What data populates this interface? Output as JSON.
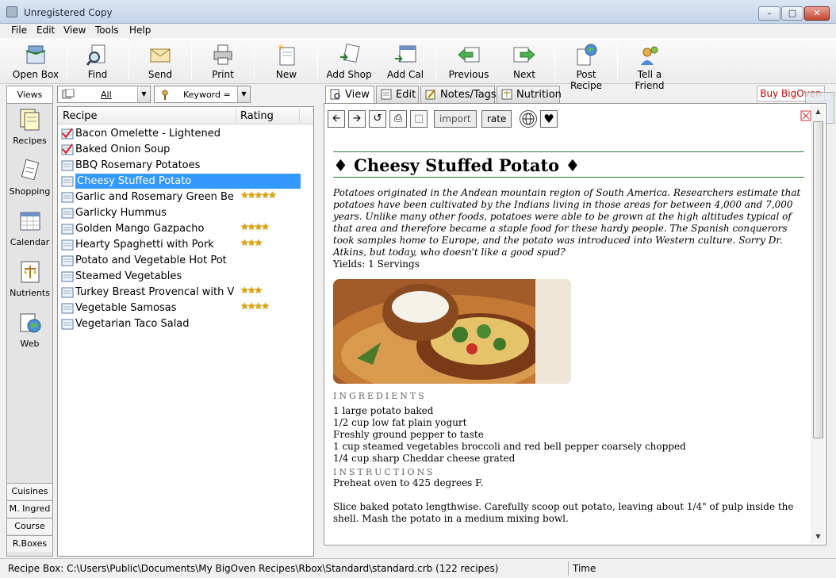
{
  "window": {
    "title": "Unregistered Copy"
  },
  "menu": [
    "File",
    "Edit",
    "View",
    "Tools",
    "Help"
  ],
  "toolbar": [
    {
      "label": "Open Box",
      "icon": "open-box-icon"
    },
    {
      "label": "Find",
      "icon": "find-icon"
    },
    {
      "label": "Send",
      "icon": "send-icon"
    },
    {
      "label": "Print",
      "icon": "print-icon"
    },
    {
      "label": "New",
      "icon": "new-icon"
    },
    {
      "label": "Add Shop",
      "icon": "add-shop-icon"
    },
    {
      "label": "Add Cal",
      "icon": "add-cal-icon"
    },
    {
      "label": "Previous",
      "icon": "previous-icon"
    },
    {
      "label": "Next",
      "icon": "next-icon"
    },
    {
      "label": "Post Recipe",
      "icon": "post-recipe-icon"
    },
    {
      "label": "Tell a Friend",
      "icon": "tell-a-friend-icon"
    }
  ],
  "views": {
    "header": "Views",
    "items": [
      "Recipes",
      "Shopping",
      "Calendar",
      "Nutrients",
      "Web"
    ],
    "tabs": [
      "Cuisines",
      "M. Ingred",
      "Course",
      "R.Boxes"
    ]
  },
  "filter": {
    "scope": "All",
    "field": "Keyword ="
  },
  "list": {
    "columns": [
      "Recipe",
      "Rating"
    ],
    "rows": [
      {
        "name": "Bacon Omelette - Lightened",
        "rating": 0,
        "checked": true
      },
      {
        "name": "Baked Onion Soup",
        "rating": 0,
        "checked": true
      },
      {
        "name": "BBQ Rosemary Potatoes",
        "rating": 0,
        "checked": false
      },
      {
        "name": "Cheesy Stuffed Potato",
        "rating": 0,
        "checked": false,
        "selected": true
      },
      {
        "name": "Garlic and Rosemary Green Be...",
        "rating": 5,
        "checked": false
      },
      {
        "name": "Garlicky Hummus",
        "rating": 0,
        "checked": false
      },
      {
        "name": "Golden Mango Gazpacho",
        "rating": 4,
        "checked": false
      },
      {
        "name": "Hearty Spaghetti with Pork",
        "rating": 3,
        "checked": false
      },
      {
        "name": "Potato and Vegetable Hot Pot",
        "rating": 0,
        "checked": false
      },
      {
        "name": "Steamed Vegetables",
        "rating": 0,
        "checked": false
      },
      {
        "name": "Turkey Breast Provencal with V...",
        "rating": 3,
        "checked": false
      },
      {
        "name": "Vegetable Samosas",
        "rating": 4,
        "checked": false
      },
      {
        "name": "Vegetarian Taco Salad",
        "rating": 0,
        "checked": false
      }
    ]
  },
  "tabs": [
    "View",
    "Edit",
    "Notes/Tags",
    "Nutrition"
  ],
  "buy_label": "Buy BigOven",
  "pane_toolbar": {
    "import": "import",
    "rate": "rate"
  },
  "recipe": {
    "title": "Cheesy Stuffed Potato",
    "description": "Potatoes originated in the Andean mountain region of South America. Researchers estimate that potatoes have been cultivated by the Indians living in those areas for between 4,000 and 7,000 years. Unlike many other foods, potatoes were able to be grown at the high altitudes typical of that area and therefore became a staple food for these hardy people. The Spanish conquerors took samples home to Europe, and the potato was introduced into Western culture. Sorry Dr. Atkins, but today, who doesn't like a good spud?",
    "yields": "Yields: 1 Servings",
    "ingredients_heading": "Ingredients",
    "ingredients": [
      "1 large potato baked",
      "1/2 cup low fat plain yogurt",
      "Freshly ground pepper to taste",
      "1 cup steamed vegetables broccoli and red bell pepper coarsely chopped",
      "1/4 cup sharp Cheddar cheese grated"
    ],
    "instructions_heading": "Instructions",
    "instructions": [
      "Preheat oven to 425 degrees F.",
      "Slice baked potato lengthwise. Carefully scoop out potato, leaving about 1/4\" of pulp inside the shell. Mash the potato in a medium mixing bowl."
    ]
  },
  "status": {
    "path": "Recipe Box: C:\\Users\\Public\\Documents\\My BigOven Recipes\\Rbox\\Standard\\standard.crb (122 recipes)",
    "time": "Time"
  }
}
